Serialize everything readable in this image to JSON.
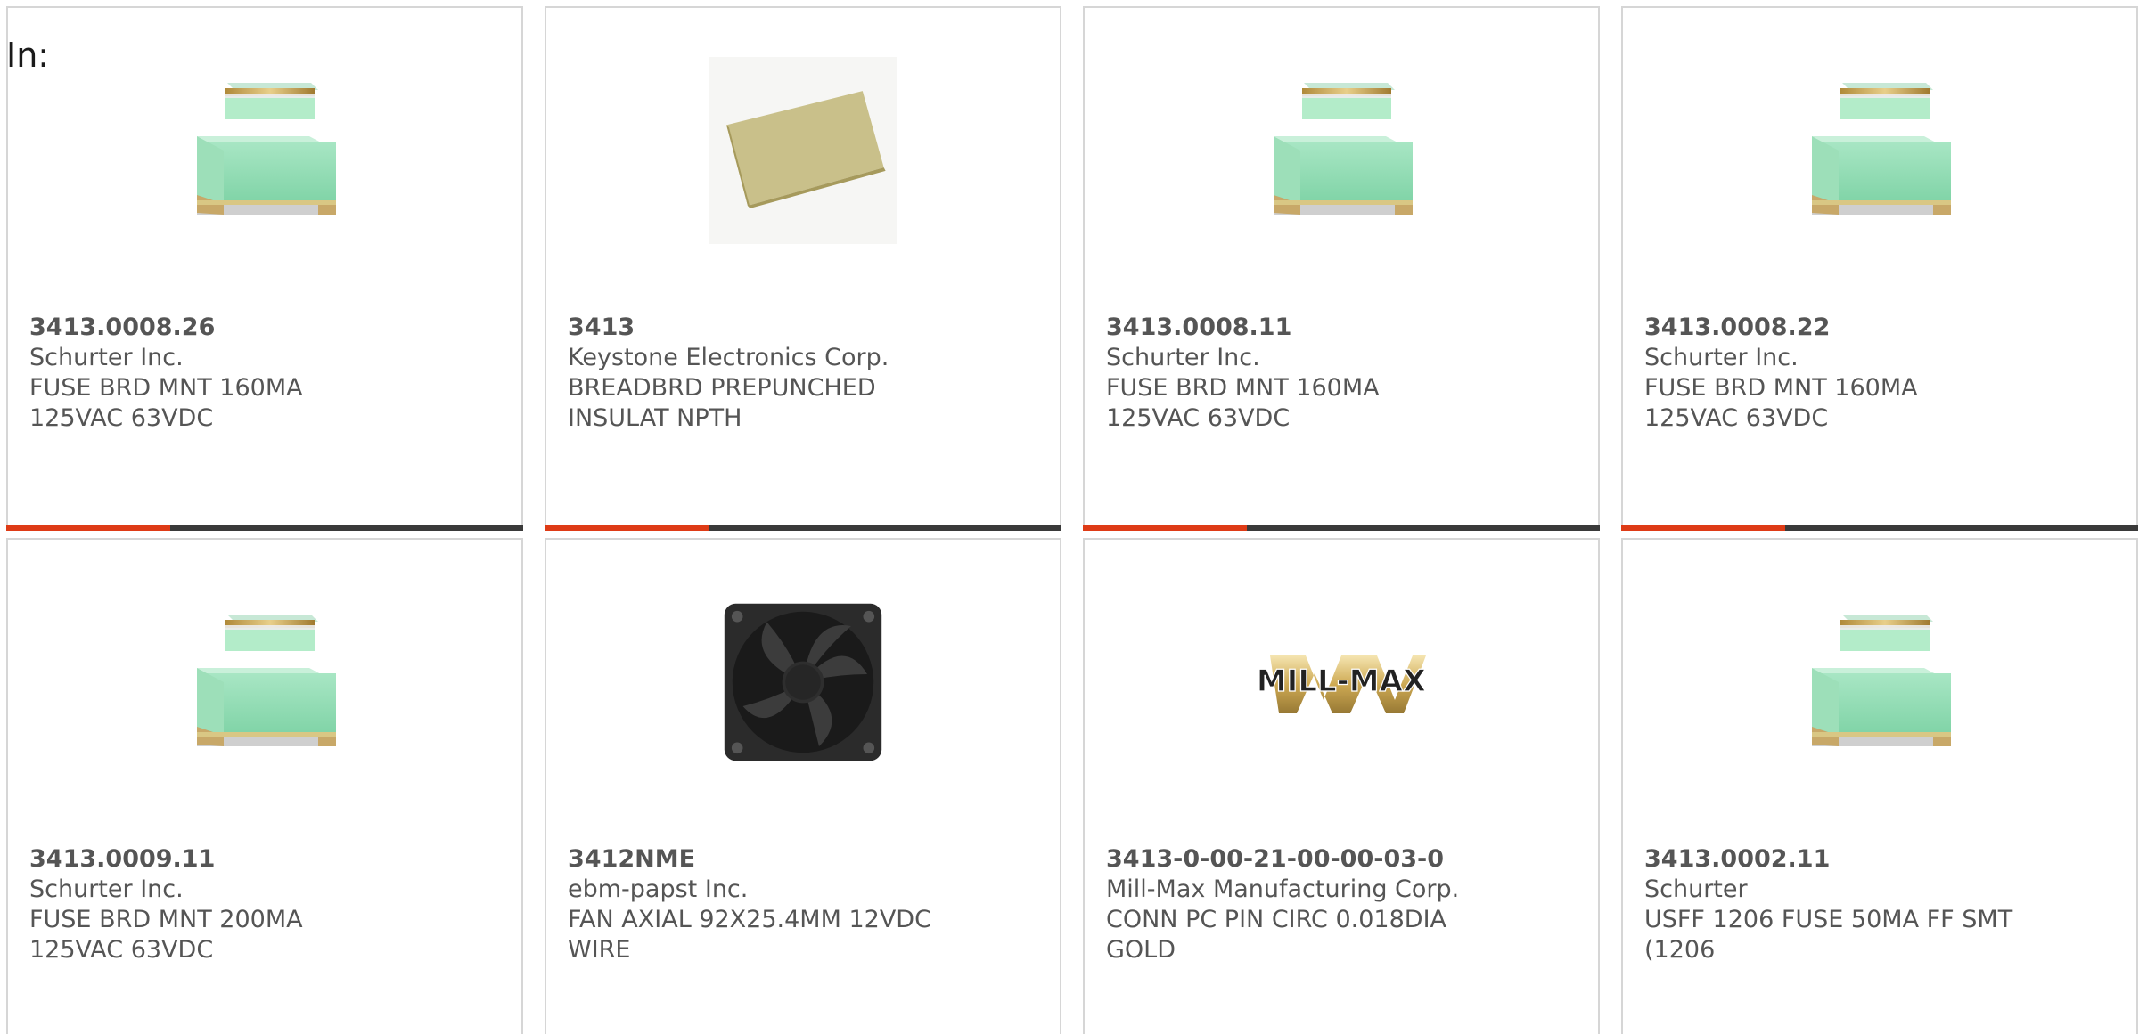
{
  "header": {
    "label": "In:"
  },
  "colors": {
    "accent": "#de3b16",
    "bar": "#3a3a3a",
    "text": "#555555",
    "border": "#d6d6d6"
  },
  "products": [
    {
      "part_number": "3413.0008.26",
      "manufacturer": "Schurter Inc.",
      "description": "FUSE BRD MNT 160MA 125VAC 63VDC",
      "image": "fuse-image"
    },
    {
      "part_number": "3413",
      "manufacturer": "Keystone Electronics Corp.",
      "description": "BREADBRD PREPUNCHED INSULAT NPTH",
      "image": "breadboard-image"
    },
    {
      "part_number": "3413.0008.11",
      "manufacturer": "Schurter Inc.",
      "description": "FUSE BRD MNT 160MA 125VAC 63VDC",
      "image": "fuse-image"
    },
    {
      "part_number": "3413.0008.22",
      "manufacturer": "Schurter Inc.",
      "description": "FUSE BRD MNT 160MA 125VAC 63VDC",
      "image": "fuse-image"
    },
    {
      "part_number": "3413.0009.11",
      "manufacturer": "Schurter Inc.",
      "description": "FUSE BRD MNT 200MA 125VAC 63VDC",
      "image": "fuse-image"
    },
    {
      "part_number": "3412NME",
      "manufacturer": "ebm-papst Inc.",
      "description": "FAN AXIAL 92X25.4MM 12VDC WIRE",
      "image": "fan-image"
    },
    {
      "part_number": "3413-0-00-21-00-00-03-0",
      "manufacturer": "Mill-Max Manufacturing Corp.",
      "description": "CONN PC PIN CIRC 0.018DIA GOLD",
      "image": "mill-max-logo",
      "logo_text": "MILL-MAX"
    },
    {
      "part_number": "3413.0002.11",
      "manufacturer": "Schurter",
      "description": "USFF 1206 FUSE 50MA FF SMT (1206",
      "image": "fuse-image"
    }
  ]
}
